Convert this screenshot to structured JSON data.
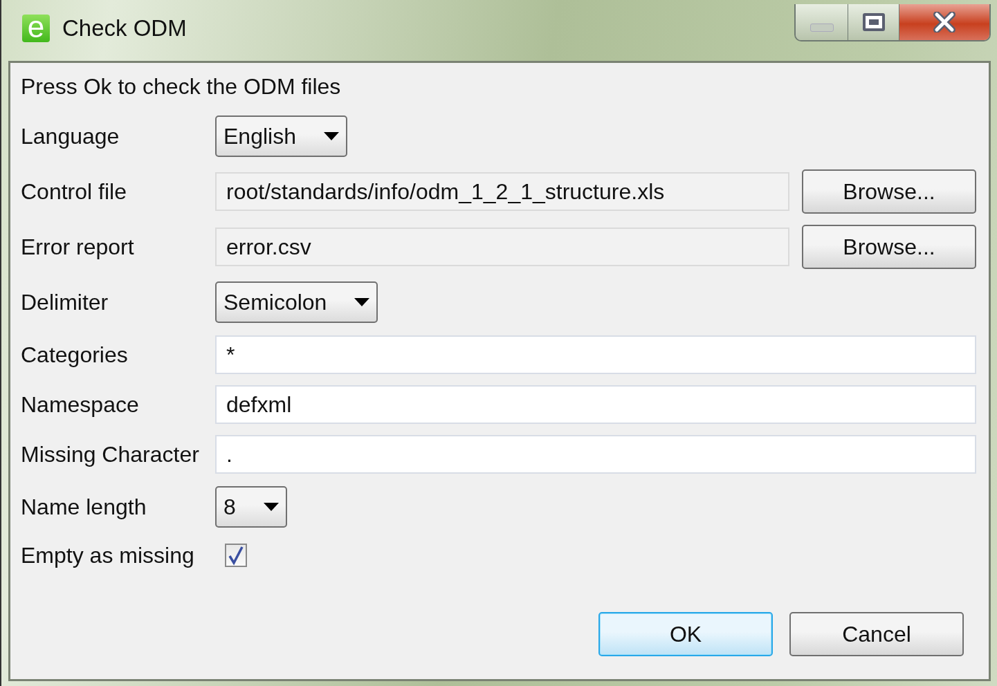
{
  "window": {
    "title": "Check ODM",
    "icon_letter": "e"
  },
  "message": "Press Ok to check the ODM files",
  "rows": [
    {
      "kind": "select",
      "label": "Language",
      "value": "English"
    },
    {
      "kind": "file",
      "label": "Control file",
      "value": "root/standards/info/odm_1_2_1_structure.xls",
      "button": "Browse..."
    },
    {
      "kind": "file",
      "label": "Error report",
      "value": "error.csv",
      "button": "Browse..."
    },
    {
      "kind": "select",
      "label": "Delimiter",
      "value": "Semicolon"
    },
    {
      "kind": "text",
      "label": "Categories",
      "value": "*"
    },
    {
      "kind": "text",
      "label": "Namespace",
      "value": "defxml"
    },
    {
      "kind": "text",
      "label": "Missing Character",
      "value": "."
    },
    {
      "kind": "select",
      "label": "Name length",
      "value": "8"
    },
    {
      "kind": "checkbox",
      "label": "Empty as missing",
      "checked": true
    }
  ],
  "buttons": [
    {
      "label": "OK",
      "default": true
    },
    {
      "label": "Cancel",
      "default": false
    }
  ]
}
